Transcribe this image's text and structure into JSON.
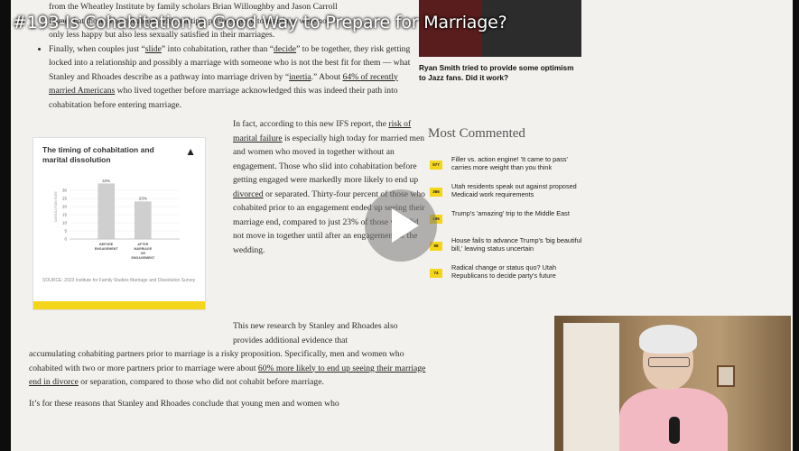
{
  "video": {
    "title": "#193-Is Cohabitation a Good Way to Prepare for Marriage?"
  },
  "article": {
    "para1_lines": [
      "from the Wheatley Institute by family scholars Brian Willoughby and Jason Carroll",
      "found that those who cohabited with multiple partners prior to marriage were not",
      "only less happy but also less sexually satisfied in their marriages."
    ],
    "bullet_parts": [
      "Finally, when couples just “",
      "slide",
      "” into cohabitation, rather than “",
      "decide",
      "” to be together, they risk getting locked into a relationship and possibly a marriage with someone who is not the best fit for them — what Stanley and Rhoades describe as a pathway into marriage driven by “",
      "inertia",
      ".” About ",
      "64% of recently married Americans",
      " who lived together before marriage acknowledged this was indeed their path into cohabitation before entering marriage."
    ],
    "col_parts": [
      "In fact, according to this new IFS report, the ",
      "risk of marital failure",
      " is especially high today for married men and women who moved in together without an engagement. Those who slid into cohabitation before getting engaged were markedly more likely to end up ",
      "divorced",
      " or separated. Thirty-four percent of those who cohabited prior to an engagement ended up seeing their marriage end, compared to just 23% of those who did not move in together until after an engagement or the wedding."
    ],
    "para_new_research": "This new research by Stanley and Rhoades also provides additional evidence that",
    "para_full_parts": [
      "accumulating cohabiting partners prior to marriage is a risky proposition. Specifically, men and women who cohabited with two or more partners prior to marriage were about ",
      "60% more likely to end up seeing their marriage end in divorce",
      " or separation, compared to those who did not cohabit before marriage."
    ],
    "para_last": "It’s for these reasons that Stanley and Rhoades conclude that young men and women who"
  },
  "chart_card": {
    "title": "The timing of cohabitation and marital dissolution",
    "logo_icon": "ifs-logo-icon",
    "source": "SOURCE: 2023 Institute for Family Studies Marriage and Dissolution Survey"
  },
  "chart_data": {
    "type": "bar",
    "title": "The timing of cohabitation and marital dissolution",
    "categories": [
      "BEFORE ENGAGEMENT",
      "AFTER MARRIAGE OR ENGAGEMENT"
    ],
    "values": [
      34,
      23
    ],
    "value_labels": [
      "34%",
      "23%"
    ],
    "ylabel": "DISSOLUTION RATE",
    "yticks": [
      0,
      5,
      10,
      15,
      20,
      25,
      30
    ],
    "ylim": [
      0,
      40
    ],
    "grid": true,
    "bar_color": "#cfcfcf"
  },
  "sidebar": {
    "thumb_caption": "Ryan Smith tried to provide some optimism to Jazz fans. Did it work?",
    "most_commented_heading": "Most Commented",
    "items": [
      {
        "count": "577",
        "text": "Filler vs. action engine! 'It came to pass' carries more weight than you think"
      },
      {
        "count": "366",
        "text": "Utah residents speak out against proposed Medicaid work requirements"
      },
      {
        "count": "186",
        "text": "Trump's 'amazing' trip to the Middle East"
      },
      {
        "count": "98",
        "text": "House fails to advance Trump's 'big beautiful bill,' leaving status uncertain"
      },
      {
        "count": "74",
        "text": "Radical change or status quo? Utah Republicans to decide party's future"
      }
    ]
  },
  "colors": {
    "accent_yellow": "#f5d519",
    "page_bg": "#f3f1ee"
  }
}
